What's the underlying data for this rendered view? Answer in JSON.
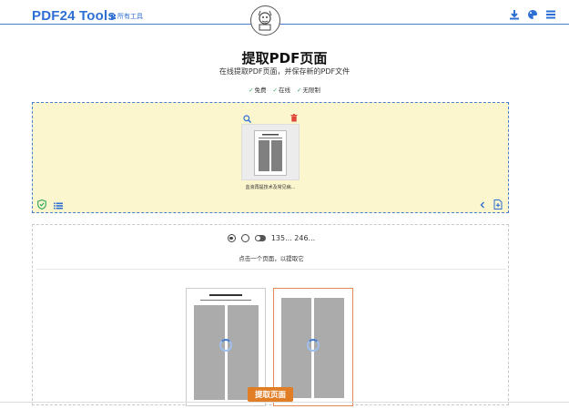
{
  "header": {
    "brand": "PDF24 Tools",
    "all_tools": "所有工具"
  },
  "main": {
    "title": "提取PDF页面",
    "subtitle": "在线提取PDF页面，并保存新的PDF文件",
    "features": [
      "免费",
      "在线",
      "无限制"
    ]
  },
  "file": {
    "name": "血液再提技术及常见病..."
  },
  "panel": {
    "selection_text": "135... 246...",
    "hint": "点击一个页面，以提取它"
  },
  "action": {
    "label": "提取页面"
  },
  "colors": {
    "brand_blue": "#2e6fd3",
    "dropzone_bg": "#fcf6cf",
    "action_orange": "#e07d25"
  }
}
